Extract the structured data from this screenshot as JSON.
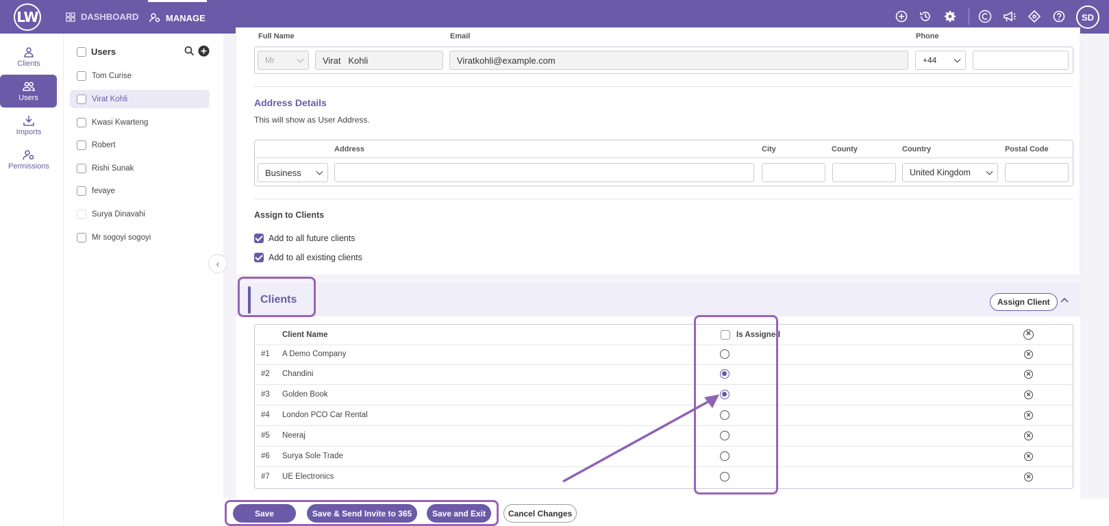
{
  "topbar": {
    "logo": "LW",
    "nav": [
      {
        "label": "DASHBOARD"
      },
      {
        "label": "MANAGE"
      }
    ],
    "icons": [
      "add-circle-icon",
      "history-icon",
      "gear-icon",
      "c-logo-icon",
      "megaphone-icon",
      "puzzle-icon",
      "help-icon"
    ],
    "avatar": "SD"
  },
  "sidebar": {
    "items": [
      {
        "label": "Clients",
        "icon": "person-icon"
      },
      {
        "label": "Users",
        "icon": "users-icon"
      },
      {
        "label": "Imports",
        "icon": "download-icon"
      },
      {
        "label": "Permissions",
        "icon": "user-gear-icon"
      }
    ]
  },
  "userlist": {
    "title": "Users",
    "users": [
      {
        "name": "Tom Curise"
      },
      {
        "name": "Virat Kohli"
      },
      {
        "name": "Kwasi Kwarteng"
      },
      {
        "name": "Robert"
      },
      {
        "name": "Rishi Sunak"
      },
      {
        "name": "fevaye"
      },
      {
        "name": "Surya Dinavahi"
      },
      {
        "name": "Mr sogoyi sogoyi"
      }
    ]
  },
  "form": {
    "full_name_label": "Full Name",
    "email_label": "Email",
    "phone_label": "Phone",
    "title_value": "Mr",
    "name_value": "Virat   Kohli",
    "email_value": "Viratkohli@example.com",
    "phone_code": "+44",
    "phone_value": ""
  },
  "address": {
    "title": "Address Details",
    "subtitle": "This will show as User Address.",
    "address_label": "Address",
    "city_label": "City",
    "county_label": "County",
    "country_label": "Country",
    "postal_label": "Postal Code",
    "type_value": "Business",
    "country_value": "United Kingdom"
  },
  "assign": {
    "title": "Assign to Clients",
    "future_label": "Add to all future clients",
    "existing_label": "Add to all existing clients"
  },
  "clients": {
    "title": "Clients",
    "assign_button": "Assign Client",
    "col_name": "Client Name",
    "col_assigned": "Is Assigned",
    "rows": [
      {
        "num": "#1",
        "name": "A Demo Company",
        "assigned": false
      },
      {
        "num": "#2",
        "name": "Chandini",
        "assigned": true
      },
      {
        "num": "#3",
        "name": "Golden Book",
        "assigned": true
      },
      {
        "num": "#4",
        "name": "London PCO Car Rental",
        "assigned": false
      },
      {
        "num": "#5",
        "name": "Neeraj",
        "assigned": false
      },
      {
        "num": "#6",
        "name": "Surya Sole Trade",
        "assigned": false
      },
      {
        "num": "#7",
        "name": "UE Electronics",
        "assigned": false
      }
    ]
  },
  "footer": {
    "save": "Save",
    "save_invite": "Save & Send Invite to 365",
    "save_exit": "Save and Exit",
    "cancel": "Cancel Changes"
  },
  "colors": {
    "brand": "#6a5aa8",
    "highlight": "#9863b8"
  }
}
